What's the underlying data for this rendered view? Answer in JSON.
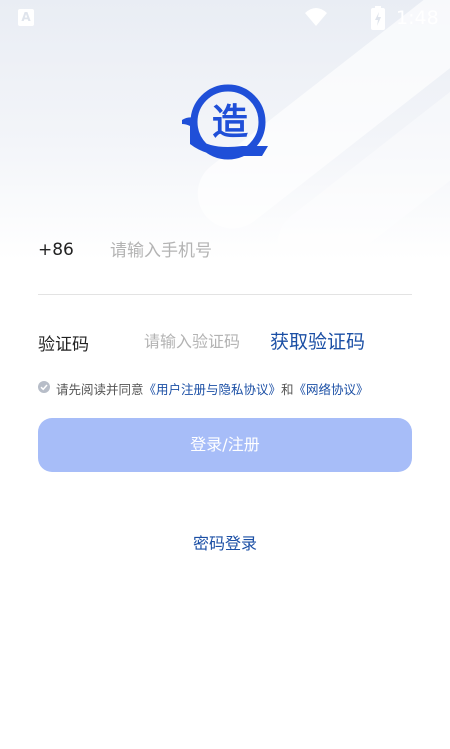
{
  "status_bar": {
    "left_icon": "A",
    "time": "1:48",
    "icons": [
      "wifi-icon",
      "battery-icon"
    ]
  },
  "logo": {
    "glyph": "造",
    "icon": "logo-icon",
    "color": "#1f4fd8"
  },
  "phone": {
    "country_code": "+86",
    "placeholder": "请输入手机号",
    "value": ""
  },
  "verification": {
    "label": "验证码",
    "placeholder": "请输入验证码",
    "value": "",
    "get_code_label": "获取验证码"
  },
  "agreement": {
    "prefix": "请先阅读并同意",
    "user_agreement_link": "《用户注册与隐私协议》",
    "conjunction": "和",
    "network_agreement_link": "《网络协议》",
    "checked": false
  },
  "login_button": {
    "label": "登录/注册"
  },
  "alt_login": {
    "label": "密码登录"
  },
  "colors": {
    "accent": "#1b4fa5",
    "button_disabled": "#a7bdf8",
    "placeholder": "#b3b3b3"
  }
}
